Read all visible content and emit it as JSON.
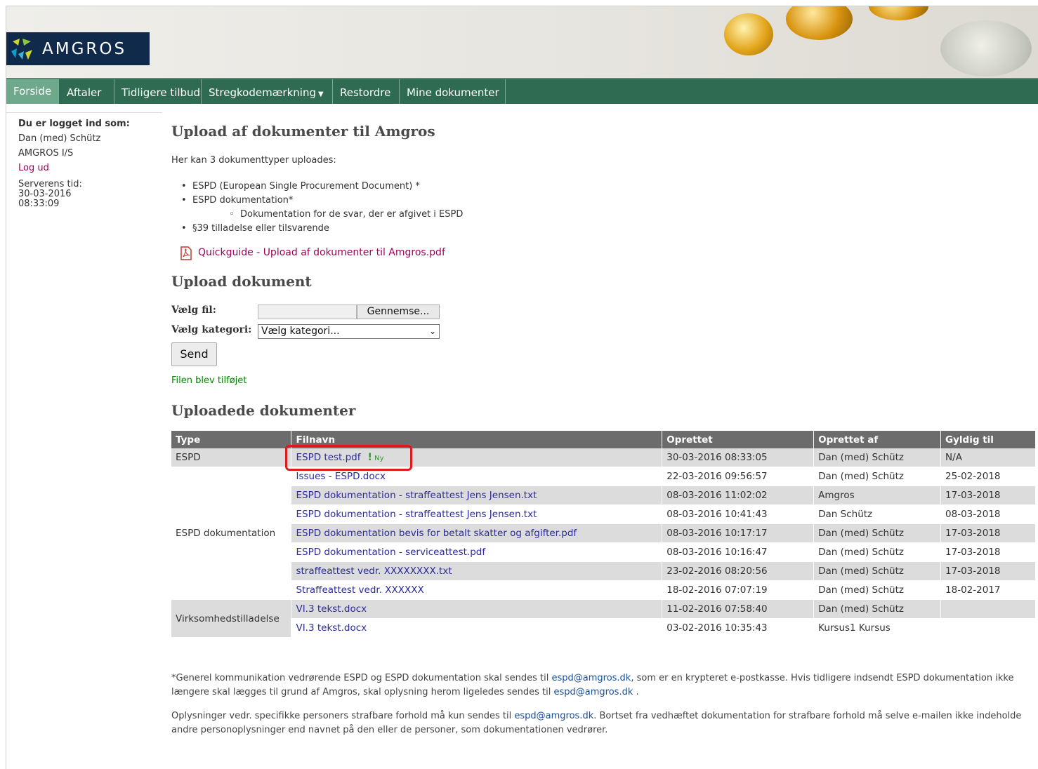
{
  "brand": {
    "logo_text": "AMGROS"
  },
  "nav": {
    "items": [
      "Forside",
      "Aftaler",
      "Tidligere tilbud",
      "Stregkodemærkning",
      "Restordre",
      "Mine dokumenter"
    ],
    "active": "Forside"
  },
  "sidebar": {
    "logged_in_label": "Du er logget ind som:",
    "user_name": "Dan (med) Schütz",
    "company": "AMGROS I/S",
    "logout": "Log ud",
    "server_time_label": "Serverens tid:",
    "server_date": "30-03-2016",
    "server_time": "08:33:09"
  },
  "main": {
    "title": "Upload af dokumenter til Amgros",
    "intro": "Her kan 3 dokumenttyper uploades:",
    "bullets": {
      "b1": "ESPD (European Single Procurement Document) *",
      "b2": "ESPD dokumentation*",
      "b2_sub": "Dokumentation for de svar, der er afgivet i ESPD",
      "b3": "§39 tilladelse eller tilsvarende"
    },
    "quickguide_link": "Quickguide - Upload af dokumenter til Amgros.pdf",
    "upload_heading": "Upload dokument",
    "file_label": "Vælg fil:",
    "browse_button": "Gennemse...",
    "category_label": "Vælg kategori:",
    "category_selected": "Vælg kategori...",
    "send_button": "Send",
    "success_message": "Filen blev tilføjet",
    "uploaded_heading": "Uploadede dokumenter"
  },
  "table": {
    "headers": [
      "Type",
      "Filnavn",
      "Oprettet",
      "Oprettet af",
      "Gyldig til"
    ],
    "new_badge": "Ny",
    "groups": {
      "espd": "ESPD",
      "espd_dok": "ESPD dokumentation",
      "virk": "Virksomhedstilladelse"
    },
    "rows": [
      {
        "file": "ESPD test.pdf",
        "created": "30-03-2016 08:33:05",
        "by": "Dan (med) Schütz",
        "valid": "N/A"
      },
      {
        "file": "Issues - ESPD.docx",
        "created": "22-03-2016 09:56:57",
        "by": "Dan (med) Schütz",
        "valid": "25-02-2018"
      },
      {
        "file": "ESPD dokumentation - straffeattest Jens Jensen.txt",
        "created": "08-03-2016 11:02:02",
        "by": "Amgros",
        "valid": "17-03-2018"
      },
      {
        "file": "ESPD dokumentation - straffeattest Jens Jensen.txt",
        "created": "08-03-2016 10:41:43",
        "by": "Dan Schütz",
        "valid": "08-03-2018"
      },
      {
        "file": "ESPD dokumentation bevis for betalt skatter og afgifter.pdf",
        "created": "08-03-2016 10:17:17",
        "by": "Dan (med) Schütz",
        "valid": "17-03-2018"
      },
      {
        "file": "ESPD dokumentation - serviceattest.pdf",
        "created": "08-03-2016 10:16:47",
        "by": "Dan (med) Schütz",
        "valid": "17-03-2018"
      },
      {
        "file": "straffeattest vedr. XXXXXXXX.txt",
        "created": "23-02-2016 08:20:56",
        "by": "Dan (med) Schütz",
        "valid": "17-03-2018"
      },
      {
        "file": "Straffeattest vedr. XXXXXX",
        "created": "18-02-2016 07:07:19",
        "by": "Dan (med) Schütz",
        "valid": "18-02-2017"
      },
      {
        "file": "VI.3 tekst.docx",
        "created": "11-02-2016 07:58:40",
        "by": "Dan (med) Schütz",
        "valid": ""
      },
      {
        "file": "VI.3 tekst.docx",
        "created": "03-02-2016 10:35:43",
        "by": "Kursus1 Kursus",
        "valid": ""
      }
    ]
  },
  "footer": {
    "p1_a": "*Generel kommunikation vedrørende ESPD og ESPD dokumentation skal sendes til ",
    "email": "espd@amgros.dk",
    "p1_b": ", som er en krypteret e-postkasse. Hvis tidligere indsendt ESPD dokumentation ikke længere skal lægges til grund af Amgros, skal oplysning herom ligeledes sendes til ",
    "p1_c": " .",
    "p2_a": "Oplysninger vedr. specifikke personers strafbare forhold må kun sendes til ",
    "p2_b": ". Bortset fra vedhæftet dokumentation for strafbare forhold må selve e-mailen ikke indeholde andre personoplysninger end navnet på den eller de personer, som dokumentationen vedrører."
  },
  "colors": {
    "nav": "#2f6b52",
    "nav_active": "#6fa98b",
    "link": "#2b2b9a",
    "accent_link": "#a0005a",
    "success": "#008a00",
    "highlight": "#e01a1a"
  }
}
